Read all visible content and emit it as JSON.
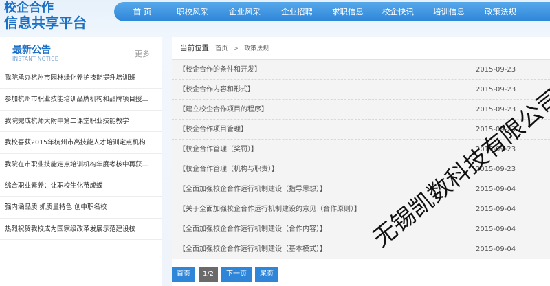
{
  "logo": {
    "line1": "校企合作",
    "line2": "信息共享平台"
  },
  "nav": [
    "首 页",
    "职校风采",
    "企业风采",
    "企业招聘",
    "求职信息",
    "校企快讯",
    "培训信息",
    "政策法规"
  ],
  "sidebar": {
    "title": "最新公告",
    "subtitle": "INSTANT NOTICE",
    "more": "更多",
    "items": [
      "我院承办杭州市园林绿化养护技能提升培训班",
      "参加杭州市职业技能培训品牌机构和品牌项目授...",
      "我院完成杭师大附中第二课堂职业技能教学",
      "我校喜获2015年杭州市高技能人才培训定点机构",
      "我院在市职业技能定点培训机构年度考核中再获...",
      "综合职业素养：让职校生化茧成蝶",
      "强内涵品质 抓质量特色 创中职名校",
      "热烈祝贺我校成为国家级改革发展示范建设校"
    ]
  },
  "breadcrumb": {
    "label": "当前位置",
    "home": "首页",
    "sep": ">",
    "current": "政策法规"
  },
  "articles": [
    {
      "title": "【校企合作的条件和开发】",
      "date": "2015-09-23"
    },
    {
      "title": "【校企合作内容和形式】",
      "date": "2015-09-23"
    },
    {
      "title": "【建立校企合作项目的程序】",
      "date": "2015-09-23"
    },
    {
      "title": "【校企合作项目管理】",
      "date": "2015-09-23"
    },
    {
      "title": "【校企合作管理（奖罚）】",
      "date": "2015-09-23"
    },
    {
      "title": "【校企合作管理（机构与职责）】",
      "date": "2015-09-23"
    },
    {
      "title": "【全面加强校企合作运行机制建设（指导思想）】",
      "date": "2015-09-04"
    },
    {
      "title": "【关于全面加强校企合作运行机制建设的意见（合作原则）】",
      "date": "2015-09-04"
    },
    {
      "title": "【全面加强校企合作运行机制建设（合作内容）】",
      "date": "2015-09-04"
    },
    {
      "title": "【全面加强校企合作运行机制建设（基本模式）】",
      "date": "2015-09-04"
    }
  ],
  "pager": {
    "first": "首页",
    "page": "1/2",
    "next": "下一页",
    "last": "尾页"
  },
  "watermark": "无锡凯数科技有限公司"
}
